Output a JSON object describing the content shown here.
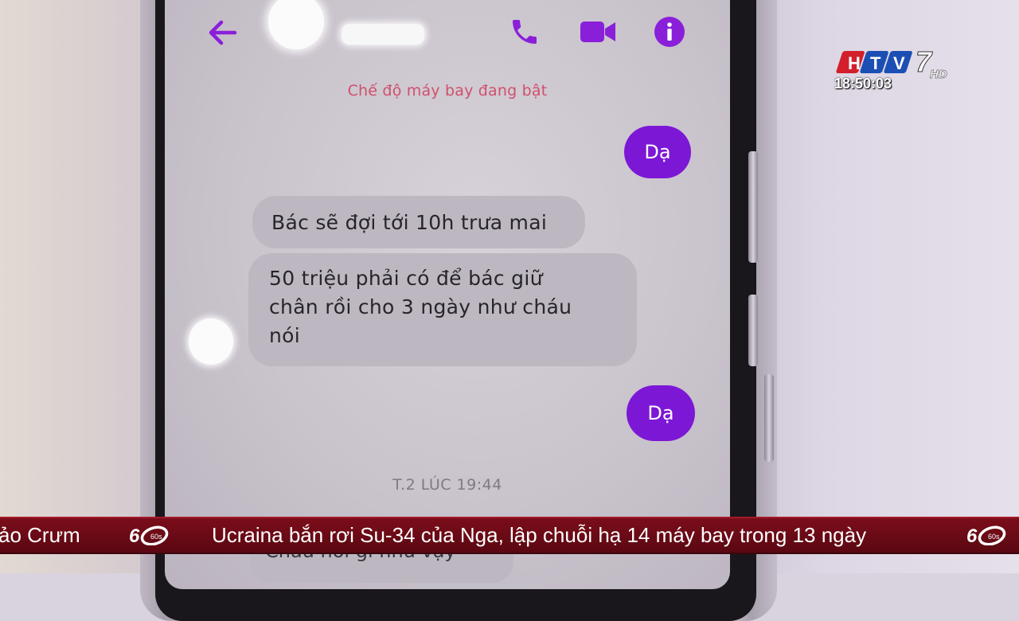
{
  "header": {
    "back_icon": "back-arrow-icon",
    "call_icon": "phone-icon",
    "video_icon": "video-camera-icon",
    "info_icon": "info-icon"
  },
  "status": {
    "airplane_mode": "Chế độ máy bay đang bật"
  },
  "messages": [
    {
      "from": "me",
      "text": "Dạ"
    },
    {
      "from": "them",
      "text": "Bác sẽ đợi tới 10h trưa mai"
    },
    {
      "from": "them",
      "lines": [
        "50 triệu phải có để bác giữ",
        "chân rồi cho 3 ngày như cháu",
        "nói"
      ]
    },
    {
      "from": "me",
      "text": "Dạ"
    }
  ],
  "timestamp": "T.2 LÚC 19:44",
  "partial_message": "Cháu nói gì như vậy",
  "broadcast": {
    "channel": "HTV7",
    "channel_suffix": "HD",
    "clock": "18:50:03",
    "ticker_prev": "ảo Crưm",
    "ticker_headline": "Ucraina bắn rơi Su-34 của Nga, lập chuỗi hạ 14 máy bay trong 13 ngày",
    "ticker_logo": "60s"
  },
  "colors": {
    "accent": "#7d17d6",
    "airplane_text": "#d0506b",
    "ticker_bg": "#6e0b17"
  }
}
